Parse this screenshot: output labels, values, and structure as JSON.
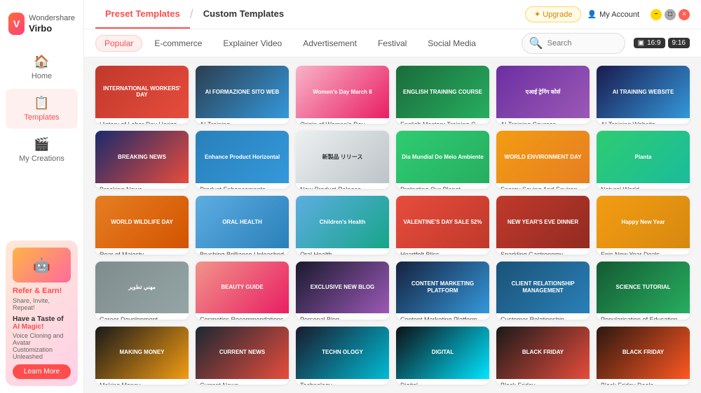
{
  "app": {
    "name": "Virbo",
    "company": "Wondershare",
    "logo_letter": "V"
  },
  "titlebar": {
    "upgrade_label": "✦ Upgrade",
    "account_label": "My Account"
  },
  "nav": {
    "items": [
      {
        "id": "home",
        "label": "Home",
        "icon": "🏠",
        "active": false
      },
      {
        "id": "templates",
        "label": "Templates",
        "icon": "📋",
        "active": true
      },
      {
        "id": "my-creations",
        "label": "My Creations",
        "icon": "🎬",
        "active": false
      }
    ]
  },
  "tabs": {
    "preset": "Preset Templates",
    "custom": "Custom Templates"
  },
  "filters": {
    "items": [
      {
        "id": "popular",
        "label": "Popular",
        "active": true
      },
      {
        "id": "ecommerce",
        "label": "E-commerce",
        "active": false
      },
      {
        "id": "explainer",
        "label": "Explainer Video",
        "active": false
      },
      {
        "id": "advertisement",
        "label": "Advertisement",
        "active": false
      },
      {
        "id": "festival",
        "label": "Festival",
        "active": false
      },
      {
        "id": "social",
        "label": "Social Media",
        "active": false
      }
    ],
    "search_placeholder": "Search",
    "ratio": "16:9",
    "duration": "9:16"
  },
  "promo": {
    "title": "Refer & Earn!",
    "subtitle": "Share, Invite, Repeat!",
    "heading": "Have a Taste of",
    "highlight": "AI Magic!",
    "description": "Voice Cloning and Avatar Customization Unleashed",
    "button": "Learn More"
  },
  "templates": [
    {
      "id": 1,
      "label": "History of Labor Day Horizontal",
      "bg": "#c0392b",
      "text": "INTERNATIONAL\nWORKERS'\nDAY",
      "accent": "#e74c3c"
    },
    {
      "id": 2,
      "label": "AI Training",
      "bg": "#2c3e50",
      "text": "AI FORMAZIONE\nSITO WEB",
      "accent": "#3498db"
    },
    {
      "id": 3,
      "label": "Origin of Women's Day",
      "bg": "#f8b4c8",
      "text": "Women's Day\nMarch 8",
      "accent": "#e91e63"
    },
    {
      "id": 4,
      "label": "English Mastery Training Courses",
      "bg": "#1a6b3a",
      "text": "ENGLISH\nTRAINING\nCOURSE",
      "accent": "#27ae60"
    },
    {
      "id": 5,
      "label": "AI Training Courses",
      "bg": "#6c2fa0",
      "text": "एआई ट्रेनिंग\nकोर्स",
      "accent": "#9b59b6"
    },
    {
      "id": 6,
      "label": "AI Training Website",
      "bg": "#1a1a4e",
      "text": "AI TRAINING\nWEBSITE",
      "accent": "#3498db"
    },
    {
      "id": 7,
      "label": "Breaking News",
      "bg": "#1a2a6c",
      "text": "BREAKING\nNEWS",
      "accent": "#e74c3c"
    },
    {
      "id": 8,
      "label": "Product Enhancements",
      "bg": "#2980b9",
      "text": "Enhance\nProduct\nHorizontal",
      "accent": "#3498db"
    },
    {
      "id": 9,
      "label": "New Product Release",
      "bg": "#fff",
      "text": "新製品\nリリース",
      "accent": "#e74c3c",
      "textColor": "#333"
    },
    {
      "id": 10,
      "label": "Protecting Our Planet",
      "bg": "#2ecc71",
      "text": "Dia Mundial\nDo Meio Ambiente",
      "accent": "#27ae60"
    },
    {
      "id": 11,
      "label": "Energy Saving And Environmental Protect...",
      "bg": "#f39c12",
      "text": "WORLD\nENVIRONMENT\nDAY",
      "accent": "#e67e22"
    },
    {
      "id": 12,
      "label": "Natural World",
      "bg": "#2ecc71",
      "text": "Pianta",
      "accent": "#27ae60"
    },
    {
      "id": 13,
      "label": "Roar of Majesty",
      "bg": "#e67e22",
      "text": "WORLD\nWILDLIFE DAY",
      "accent": "#d35400"
    },
    {
      "id": 14,
      "label": "Brushing Brilliance Unleashed",
      "bg": "#5dade2",
      "text": "ORAL\nHEALTH",
      "accent": "#2980b9"
    },
    {
      "id": 15,
      "label": "Oral Health",
      "bg": "#5dade2",
      "text": "Children's\nHealth",
      "accent": "#2980b9"
    },
    {
      "id": 16,
      "label": "Heartfelt Bliss",
      "bg": "#e74c3c",
      "text": "VALENTINE'S DAY\nSALE 52%",
      "accent": "#c0392b"
    },
    {
      "id": 17,
      "label": "Sparkling Gastronomy",
      "bg": "#c0392b",
      "text": "NEW YEAR'S\nEVE DINNER",
      "accent": "#e74c3c"
    },
    {
      "id": 18,
      "label": "Epic New Year Deals",
      "bg": "#f39c12",
      "text": "Happy\nNew Year",
      "accent": "#e67e22"
    },
    {
      "id": 19,
      "label": "Career Development",
      "bg": "#7f8c8d",
      "text": "مهني\nتطوير",
      "accent": "#95a5a6"
    },
    {
      "id": 20,
      "label": "Cosmetics Recommendations",
      "bg": "#f1948a",
      "text": "BEAUTY\nGUIDE",
      "accent": "#e91e63"
    },
    {
      "id": 21,
      "label": "Personal Blog",
      "bg": "#1a1a2e",
      "text": "EXCLUSIVE\nNEW BLOG",
      "accent": "#9b59b6"
    },
    {
      "id": 22,
      "label": "Content Marketing Platform",
      "bg": "#16213e",
      "text": "CONTENT\nMARKETING\nPLATFORM",
      "accent": "#3498db"
    },
    {
      "id": 23,
      "label": "Customer Relationship",
      "bg": "#1a5276",
      "text": "CLIENT\nRELATIONSHIP\nMANAGEMENT",
      "accent": "#2980b9"
    },
    {
      "id": 24,
      "label": "Popularisation of Education",
      "bg": "#145a32",
      "text": "SCIENCE\nTUTORIAL",
      "accent": "#27ae60"
    },
    {
      "id": 25,
      "label": "Making Money",
      "bg": "#1a1a1a",
      "text": "MAKING\nMONEY",
      "accent": "#f39c12"
    },
    {
      "id": 26,
      "label": "Current News",
      "bg": "#1c2833",
      "text": "CURRENT\nNEWS",
      "accent": "#e74c3c"
    },
    {
      "id": 27,
      "label": "Technology",
      "bg": "#1a1a2e",
      "text": "TECHN\nOLOGY",
      "accent": "#00bcd4"
    },
    {
      "id": 28,
      "label": "Digital",
      "bg": "#0d1117",
      "text": "DIGITAL",
      "accent": "#00e5ff"
    },
    {
      "id": 29,
      "label": "Black Friday",
      "bg": "#1a1a1a",
      "text": "BLACK\nFRIDAY",
      "accent": "#e74c3c"
    },
    {
      "id": 30,
      "label": "Black Friday Deals",
      "bg": "#2c1810",
      "text": "BLACK\nFRIDAY",
      "accent": "#ff5722"
    }
  ]
}
